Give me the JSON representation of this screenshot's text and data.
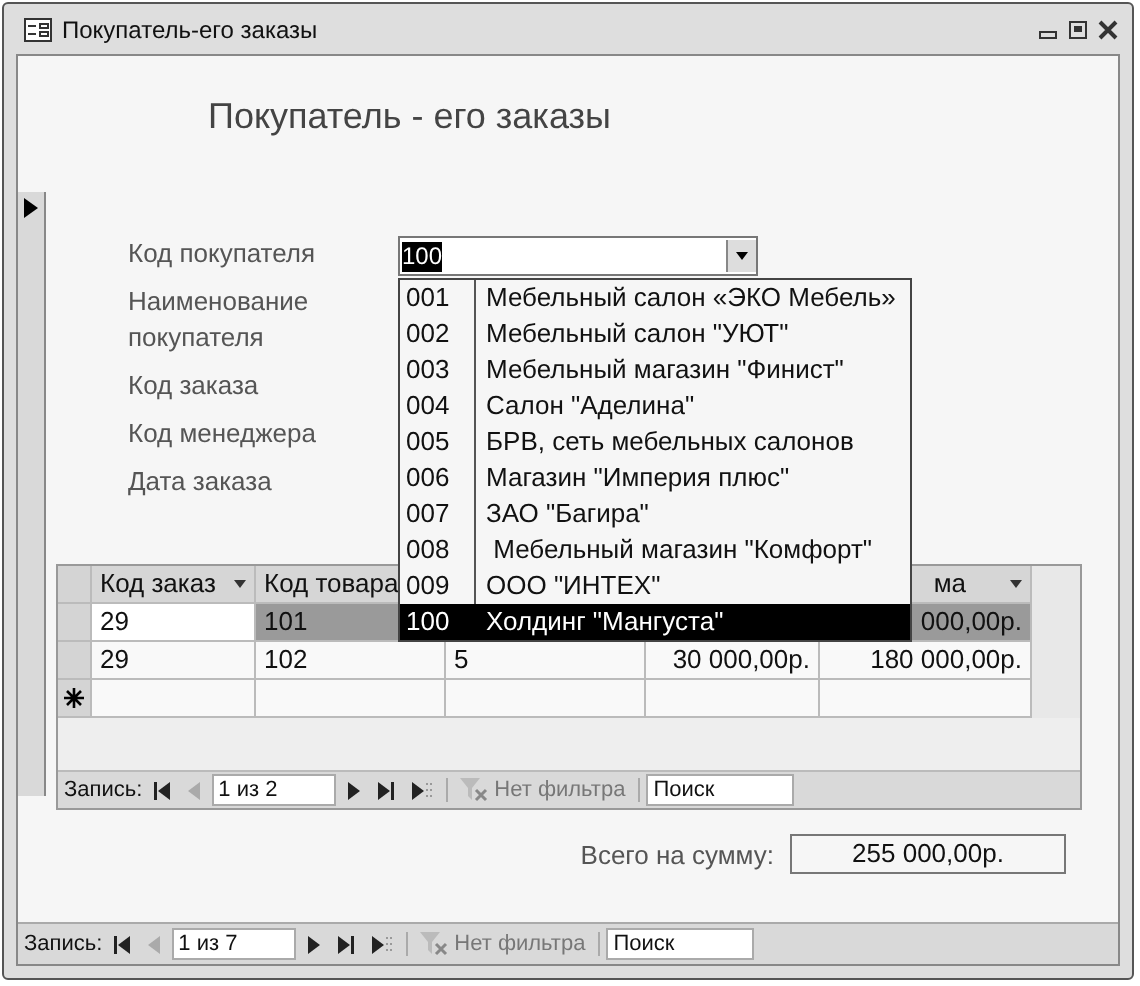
{
  "window": {
    "title": "Покупатель-его заказы"
  },
  "form": {
    "heading": "Покупатель - его заказы",
    "fields": [
      {
        "label": "Код покупателя",
        "value": "100"
      },
      {
        "label": "Наименование покупателя"
      },
      {
        "label": "Код заказа"
      },
      {
        "label": "Код менеджера"
      },
      {
        "label": "Дата заказа"
      }
    ],
    "dropdown": [
      {
        "code": "001",
        "name": "Мебельный салон «ЭКО Мебель»",
        "selected": false
      },
      {
        "code": "002",
        "name": "Мебельный салон \"УЮТ\"",
        "selected": false
      },
      {
        "code": "003",
        "name": "Мебельный магазин \"Финист\"",
        "selected": false
      },
      {
        "code": "004",
        "name": "Салон \"Аделина\"",
        "selected": false
      },
      {
        "code": "005",
        "name": "БРВ, сеть мебельных салонов",
        "selected": false
      },
      {
        "code": "006",
        "name": "Магазин \"Империя плюс\"",
        "selected": false
      },
      {
        "code": "007",
        "name": "ЗАО \"Багира\"",
        "selected": false
      },
      {
        "code": "008",
        "name": " Мебельный магазин \"Комфорт\"",
        "selected": false
      },
      {
        "code": "009",
        "name": "ООО \"ИНТЕХ\"",
        "selected": false
      },
      {
        "code": "100",
        "name": "Холдинг \"Мангуста\"",
        "selected": true
      }
    ]
  },
  "subform": {
    "columns": [
      {
        "label": "Код заказ",
        "sort_menu": true
      },
      {
        "label": "Код товара"
      },
      {},
      {},
      {
        "label": "ма",
        "sort_menu": true
      }
    ],
    "rows": [
      {
        "selected": true,
        "cells": [
          "29",
          "101",
          null,
          null,
          "000,00р."
        ]
      },
      {
        "selected": false,
        "cells": [
          "29",
          "102",
          "5",
          "30 000,00р.",
          "180 000,00р."
        ]
      }
    ],
    "nav": {
      "label": "Запись:",
      "position": "1 из 2",
      "filter": "Нет фильтра",
      "search": "Поиск"
    }
  },
  "total": {
    "label": "Всего на сумму:",
    "value": "255 000,00р."
  },
  "nav": {
    "label": "Запись:",
    "position": "1 из 7",
    "filter": "Нет фильтра",
    "search": "Поиск"
  }
}
